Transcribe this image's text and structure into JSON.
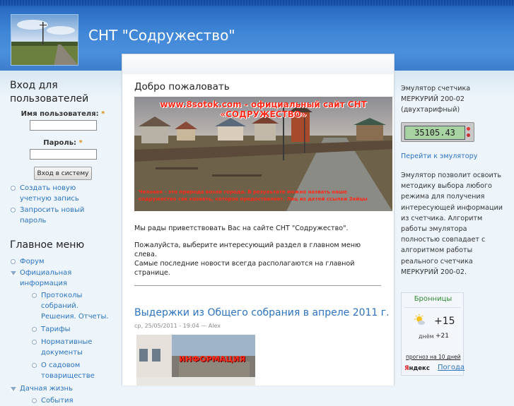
{
  "site": {
    "name": "СНТ \"Содружество\""
  },
  "login": {
    "title": "Вход для пользователей",
    "username_label": "Имя пользователя:",
    "password_label": "Пароль:",
    "required_mark": "*",
    "submit_label": "Вход в систему",
    "links": [
      "Создать новую учетную запись",
      "Запросить новый пароль"
    ]
  },
  "main_menu": {
    "title": "Главное меню",
    "items": [
      {
        "label": "Форум"
      },
      {
        "label": "Официальная информация"
      },
      {
        "label": "Дачная жизнь"
      }
    ],
    "sub_items": [
      "Протоколы собраний. Решения. Отчеты.",
      "Тарифы",
      "Нормативные документы",
      "О садовом товариществе"
    ],
    "cut_item": "События"
  },
  "welcome": {
    "title": "Добро пожаловать",
    "banner_heading": "www.8sotok.com - официальный сайт СНТ «СОДРУЖЕСТВО»",
    "banner_caption": "Человек - это природа возле города. В результате можно назвать наше содружество так назвать, которое предоставляет. Лиц из детей ссылки Зайцы",
    "paragraphs": [
      "Мы рады приветствовать Вас на сайте СНТ \"Содружество\".",
      "Пожалуйста, выберите интересующий раздел в главном меню слева.",
      "Самые последние новости всегда располагаются на главной странице."
    ]
  },
  "news": {
    "title": "Выдержки из Общего собрания в апреле 2011 г.",
    "submitted": "ср, 25/05/2011 - 19:04 — Alex",
    "image_text": "ИНФОРМАЦИЯ"
  },
  "emulator": {
    "title": "Эмулятор счетчика МЕРКУРИЙ 200-02 (двухтарифный)",
    "reading": "35105.43",
    "link": "Перейти к эмулятору",
    "description": "Эмулятор позволит освоить методику выбора любого режима для получения интересующей информации из счетчика. Алгоритм работы эмулятора полностью совпадает с алгоритмом работы реального счетчика МЕРКУРИЙ 200-02."
  },
  "weather": {
    "city": "Бронницы",
    "temp": "+15",
    "day_label": "днём",
    "day_temp": "+21",
    "forecast_link": "прогноз на 10 дней",
    "brand_y": "Я",
    "brand_rest": "ндекс",
    "pogoda_link": "Погода",
    "icon": "sun-cloud-icon"
  },
  "colors": {
    "accent": "#2b73c0",
    "header": "#3f86d6",
    "background": "#edf5fa"
  }
}
